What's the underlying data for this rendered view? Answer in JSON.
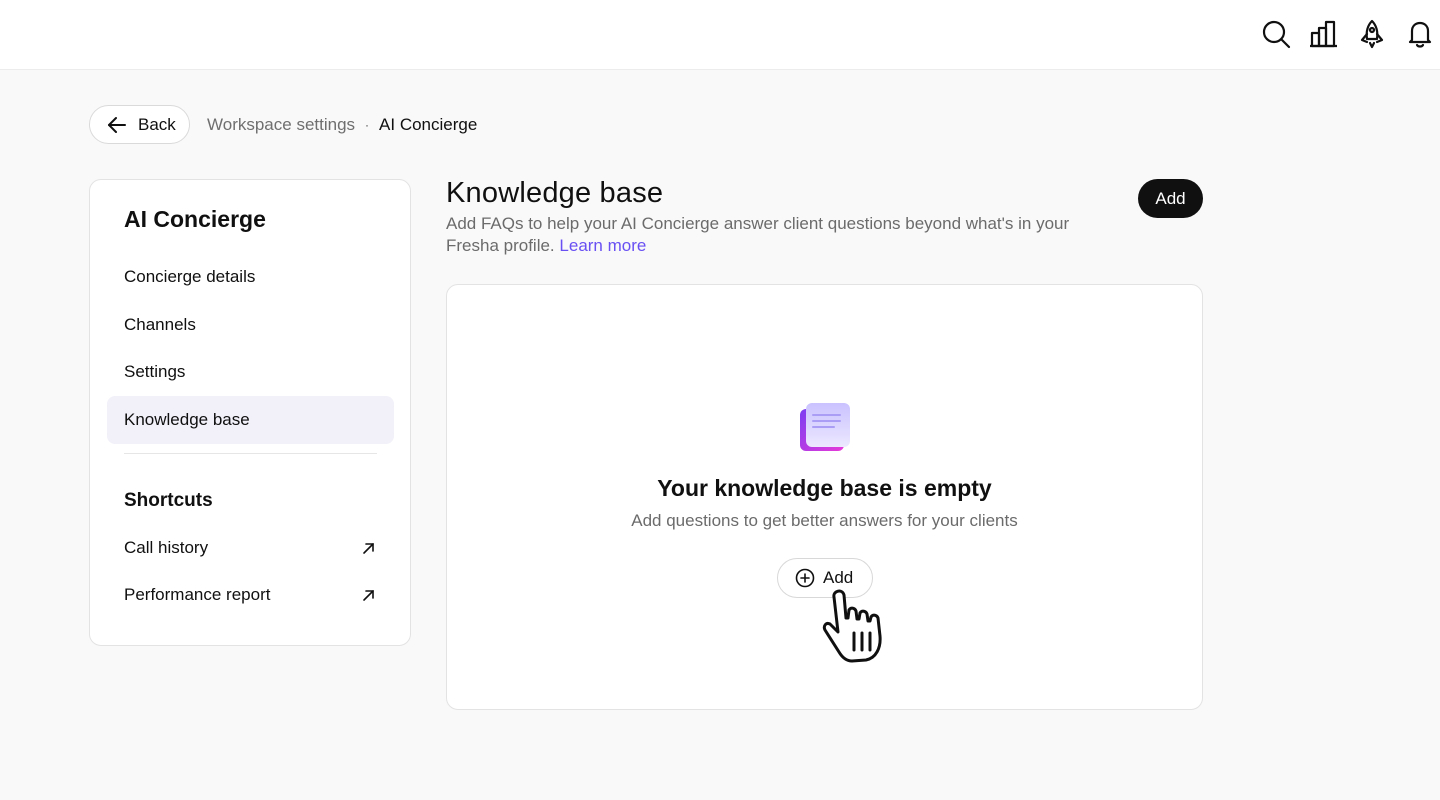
{
  "header": {
    "icons": [
      "search-icon",
      "chart-icon",
      "rocket-icon",
      "bell-icon"
    ]
  },
  "nav": {
    "back_label": "Back",
    "breadcrumb": {
      "parent": "Workspace settings",
      "separator": "·",
      "current": "AI Concierge"
    }
  },
  "sidebar": {
    "title": "AI Concierge",
    "items": [
      {
        "label": "Concierge details"
      },
      {
        "label": "Channels"
      },
      {
        "label": "Settings"
      },
      {
        "label": "Knowledge base",
        "active": true
      }
    ],
    "shortcuts_title": "Shortcuts",
    "shortcuts": [
      {
        "label": "Call history"
      },
      {
        "label": "Performance report"
      }
    ]
  },
  "main": {
    "title": "Knowledge base",
    "description": "Add FAQs to help your AI Concierge answer client questions beyond what's in your Fresha profile.",
    "learn_more": "Learn more",
    "add_label": "Add",
    "empty": {
      "title": "Your knowledge base is empty",
      "subtitle": "Add questions to get better answers for your clients",
      "add_label": "Add"
    }
  },
  "colors": {
    "accent": "#6950f3",
    "primary_button": "#101010",
    "active_nav_bg": "#f2f1fa"
  }
}
